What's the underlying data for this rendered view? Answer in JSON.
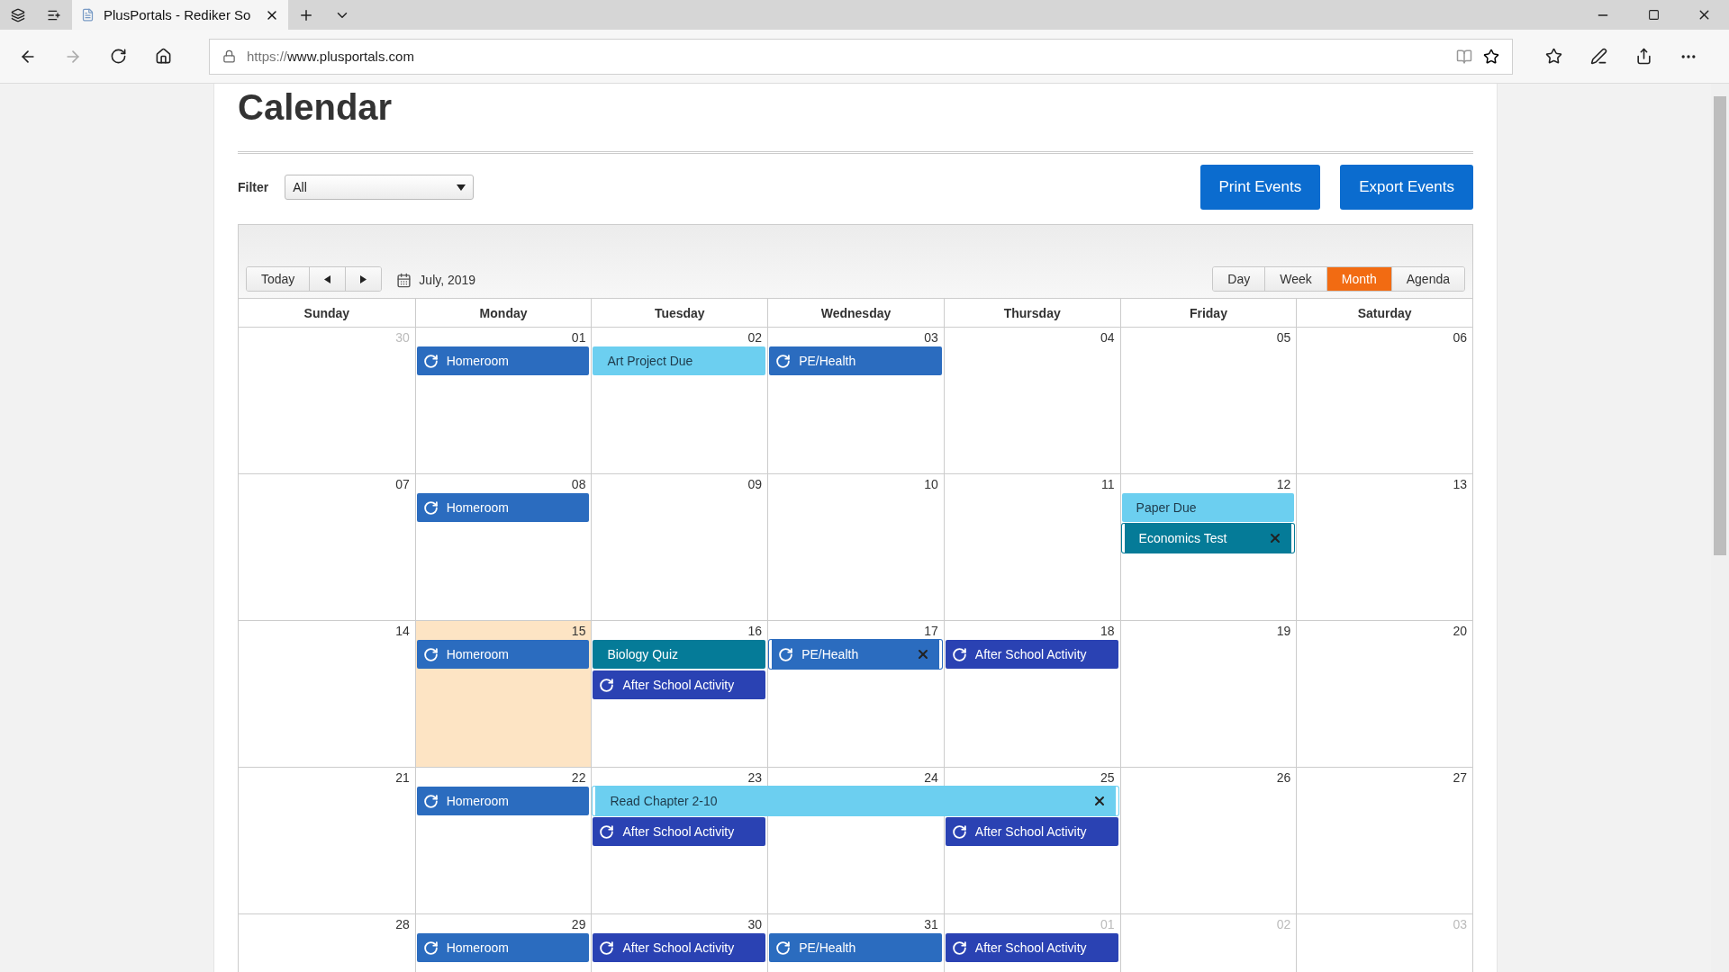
{
  "browser": {
    "tab_title": "PlusPortals - Rediker So",
    "url_scheme": "https://",
    "url_host": "www.plusportals.com"
  },
  "page": {
    "title": "Calendar"
  },
  "filter": {
    "label": "Filter",
    "value": "All"
  },
  "actions": [
    "Print Events",
    "Export Events"
  ],
  "toolbar": {
    "today": "Today",
    "month_label": "July, 2019",
    "views": [
      {
        "label": "Day",
        "selected": false
      },
      {
        "label": "Week",
        "selected": false
      },
      {
        "label": "Month",
        "selected": true
      },
      {
        "label": "Agenda",
        "selected": false
      }
    ]
  },
  "weekdays": [
    "Sunday",
    "Monday",
    "Tuesday",
    "Wednesday",
    "Thursday",
    "Friday",
    "Saturday"
  ],
  "weeks": [
    {
      "days": [
        {
          "date": "30",
          "other_month": true,
          "today": false
        },
        {
          "date": "01",
          "other_month": false,
          "today": false,
          "events": [
            {
              "title": "Homeroom",
              "kind": "recurring",
              "color": "#2b6cbf",
              "selected": false
            }
          ]
        },
        {
          "date": "02",
          "other_month": false,
          "today": false,
          "events": [
            {
              "title": "Art Project Due",
              "kind": "single",
              "color": "#6ccff0",
              "selected": false
            }
          ]
        },
        {
          "date": "03",
          "other_month": false,
          "today": false,
          "events": [
            {
              "title": "PE/Health",
              "kind": "recurring",
              "color": "#2b6cbf",
              "selected": false
            }
          ]
        },
        {
          "date": "04",
          "other_month": false,
          "today": false
        },
        {
          "date": "05",
          "other_month": false,
          "today": false
        },
        {
          "date": "06",
          "other_month": false,
          "today": false
        }
      ]
    },
    {
      "days": [
        {
          "date": "07",
          "other_month": false,
          "today": false
        },
        {
          "date": "08",
          "other_month": false,
          "today": false,
          "events": [
            {
              "title": "Homeroom",
              "kind": "recurring",
              "color": "#2b6cbf",
              "selected": false
            }
          ]
        },
        {
          "date": "09",
          "other_month": false,
          "today": false
        },
        {
          "date": "10",
          "other_month": false,
          "today": false
        },
        {
          "date": "11",
          "other_month": false,
          "today": false
        },
        {
          "date": "12",
          "other_month": false,
          "today": false,
          "events": [
            {
              "title": "Paper Due",
              "kind": "single",
              "color": "#6ccff0",
              "selected": false
            },
            {
              "title": "Economics Test",
              "kind": "single",
              "color": "#057b98",
              "selected": true
            }
          ]
        },
        {
          "date": "13",
          "other_month": false,
          "today": false
        }
      ]
    },
    {
      "days": [
        {
          "date": "14",
          "other_month": false,
          "today": false
        },
        {
          "date": "15",
          "other_month": false,
          "today": true,
          "events": [
            {
              "title": "Homeroom",
              "kind": "recurring",
              "color": "#2b6cbf",
              "selected": false
            }
          ]
        },
        {
          "date": "16",
          "other_month": false,
          "today": false,
          "events": [
            {
              "title": "Biology Quiz",
              "kind": "single",
              "color": "#057b98",
              "selected": false
            },
            {
              "title": "After School Activity",
              "kind": "recurring",
              "color": "#2a42b3",
              "selected": false
            }
          ]
        },
        {
          "date": "17",
          "other_month": false,
          "today": false,
          "events": [
            {
              "title": "PE/Health",
              "kind": "recurring",
              "color": "#2b6cbf",
              "selected": true
            }
          ]
        },
        {
          "date": "18",
          "other_month": false,
          "today": false,
          "events": [
            {
              "title": "After School Activity",
              "kind": "recurring",
              "color": "#2a42b3",
              "selected": false
            }
          ]
        },
        {
          "date": "19",
          "other_month": false,
          "today": false
        },
        {
          "date": "20",
          "other_month": false,
          "today": false
        }
      ]
    },
    {
      "days": [
        {
          "date": "21",
          "other_month": false,
          "today": false
        },
        {
          "date": "22",
          "other_month": false,
          "today": false,
          "events": [
            {
              "title": "Homeroom",
              "kind": "recurring",
              "color": "#2b6cbf",
              "selected": false
            }
          ]
        },
        {
          "date": "23",
          "other_month": false,
          "today": false,
          "events": [
            {
              "title": "Read Chapter 2-10",
              "kind": "single",
              "color": "#6ccff0",
              "selected": true
            },
            {
              "title": "After School Activity",
              "kind": "recurring",
              "color": "#2a42b3",
              "selected": false
            }
          ]
        },
        {
          "date": "24",
          "other_month": false,
          "today": false,
          "events": [
            {
              "kind": "continued"
            }
          ]
        },
        {
          "date": "25",
          "other_month": false,
          "today": false,
          "events": [
            {
              "kind": "continued"
            },
            {
              "title": "After School Activity",
              "kind": "recurring",
              "color": "#2a42b3",
              "selected": false
            }
          ]
        },
        {
          "date": "26",
          "other_month": false,
          "today": false
        },
        {
          "date": "27",
          "other_month": false,
          "today": false
        }
      ]
    },
    {
      "days": [
        {
          "date": "28",
          "other_month": false,
          "today": false
        },
        {
          "date": "29",
          "other_month": false,
          "today": false,
          "events": [
            {
              "title": "Homeroom",
              "kind": "recurring",
              "color": "#2b6cbf",
              "selected": false
            }
          ]
        },
        {
          "date": "30",
          "other_month": false,
          "today": false,
          "events": [
            {
              "title": "After School Activity",
              "kind": "recurring",
              "color": "#2a42b3",
              "selected": false
            }
          ]
        },
        {
          "date": "31",
          "other_month": false,
          "today": false,
          "events": [
            {
              "title": "PE/Health",
              "kind": "recurring",
              "color": "#2b6cbf",
              "selected": false
            }
          ]
        },
        {
          "date": "01",
          "other_month": true,
          "today": false,
          "events": [
            {
              "title": "After School Activity",
              "kind": "recurring",
              "color": "#2a42b3",
              "selected": false
            }
          ]
        },
        {
          "date": "02",
          "other_month": true,
          "today": false
        },
        {
          "date": "03",
          "other_month": true,
          "today": false
        }
      ]
    }
  ]
}
